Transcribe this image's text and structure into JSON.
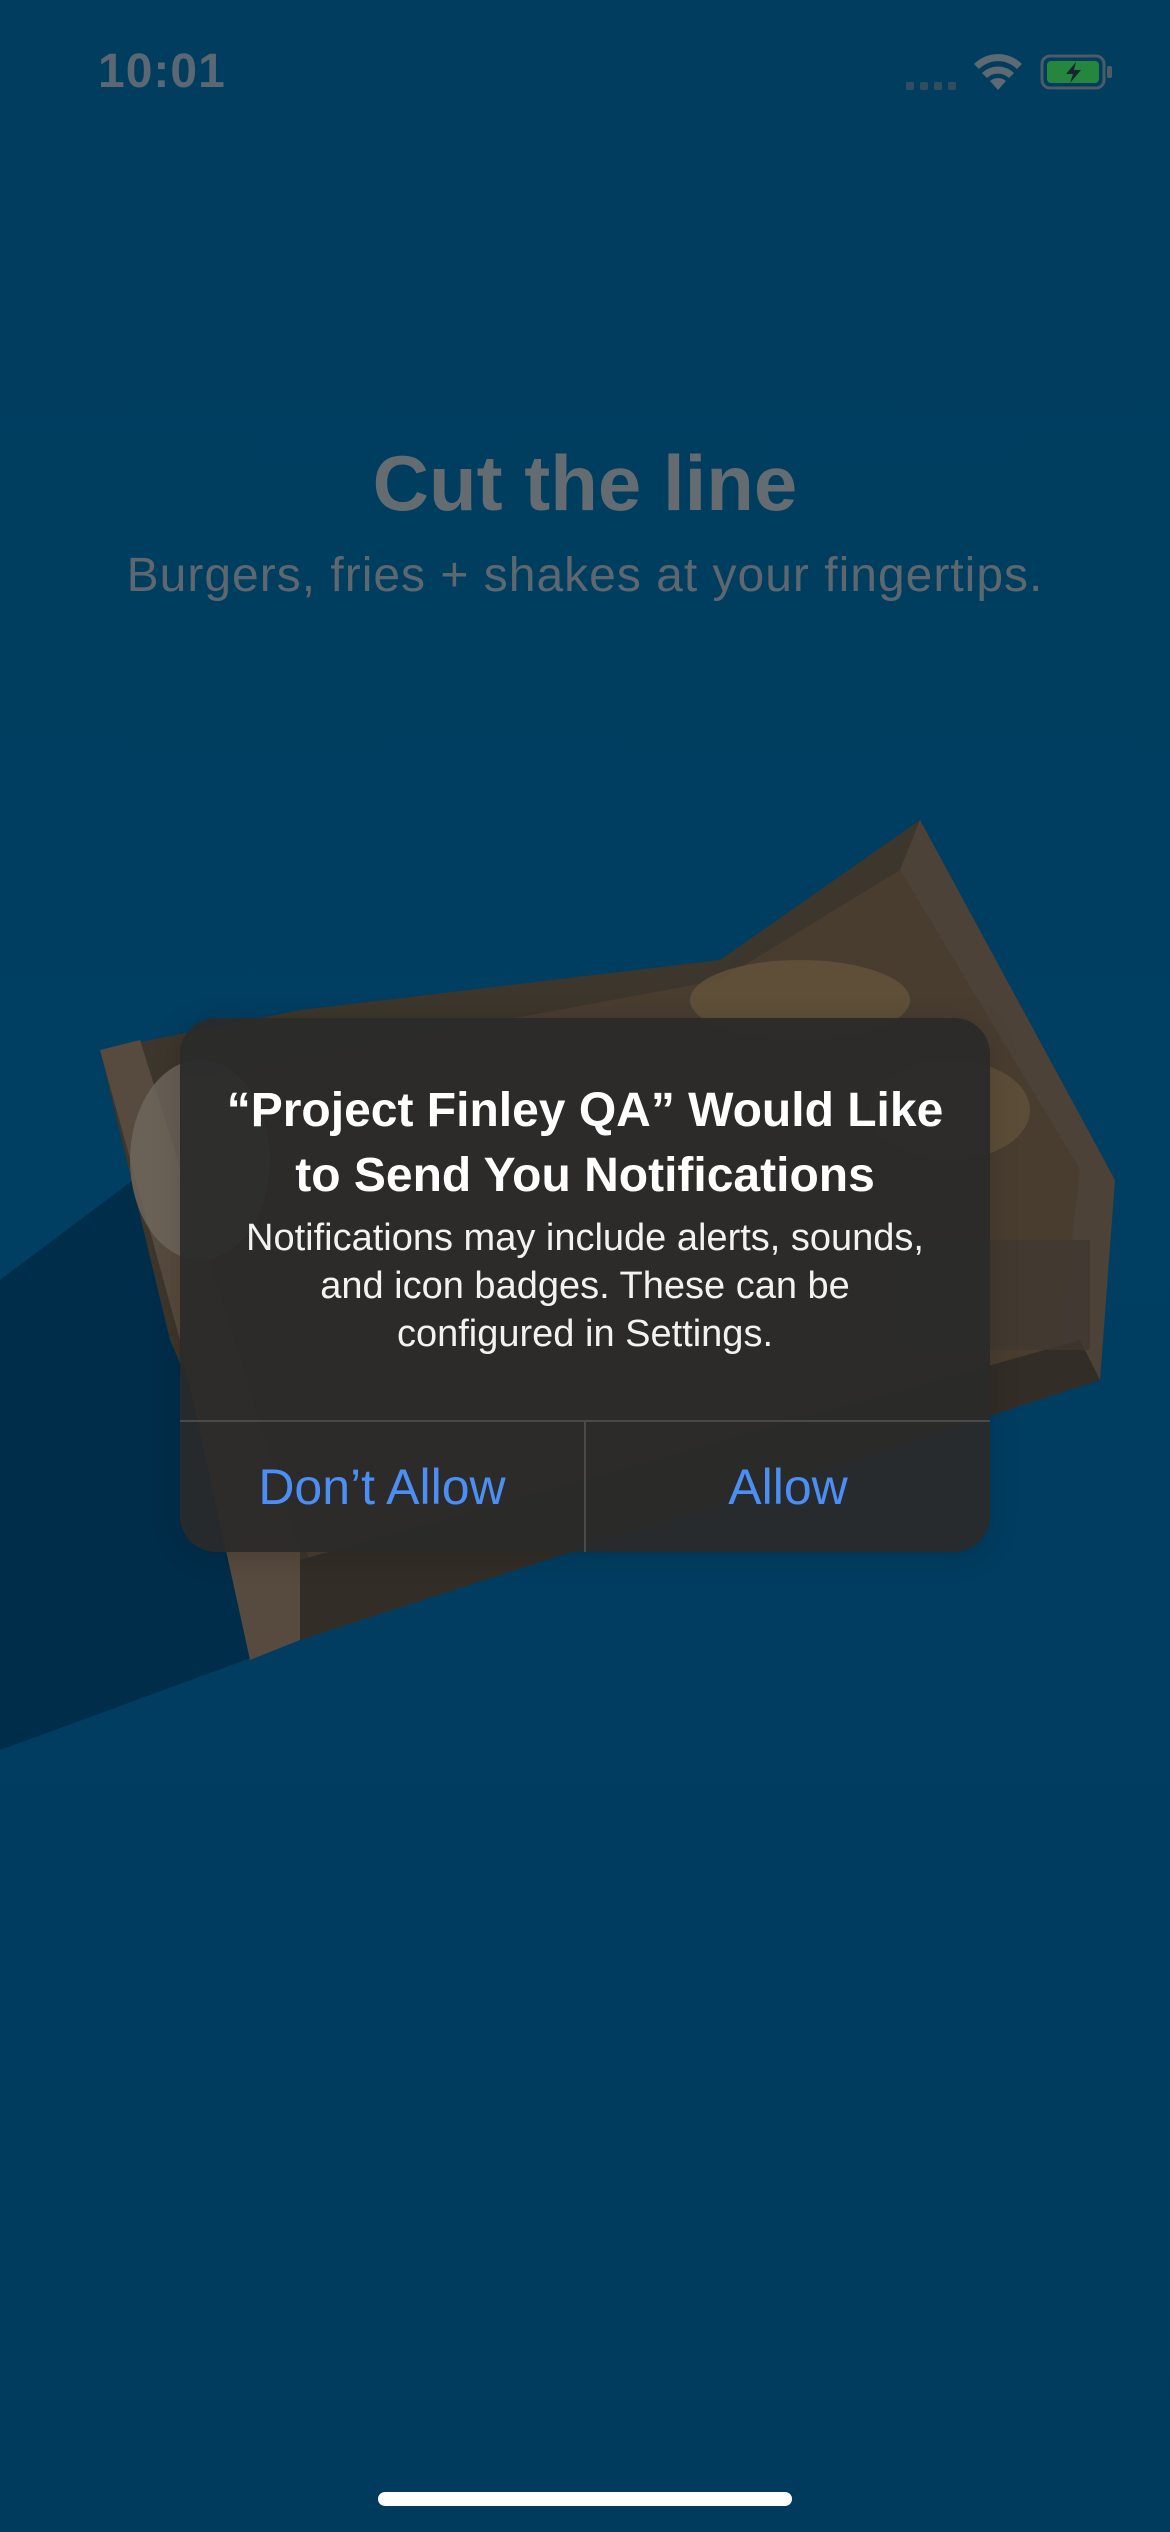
{
  "status_bar": {
    "time": "10:01",
    "icons": [
      "cell-signal-icon",
      "wifi-icon",
      "battery-charging-icon"
    ],
    "battery_color": "#2ea043"
  },
  "hero": {
    "title": "Cut the line",
    "subtitle": "Burgers, fries + shakes at your fingertips."
  },
  "alert": {
    "title": "“Project Finley QA” Would Like to Send You Notifications",
    "message": "Notifications may include alerts, sounds, and icon badges. These can be configured in Settings.",
    "buttons": {
      "dont_allow": "Don’t Allow",
      "allow": "Allow"
    },
    "button_color": "#4b8ff5"
  },
  "colors": {
    "background": "#00466e",
    "alert_background": "#2a2a2a"
  }
}
